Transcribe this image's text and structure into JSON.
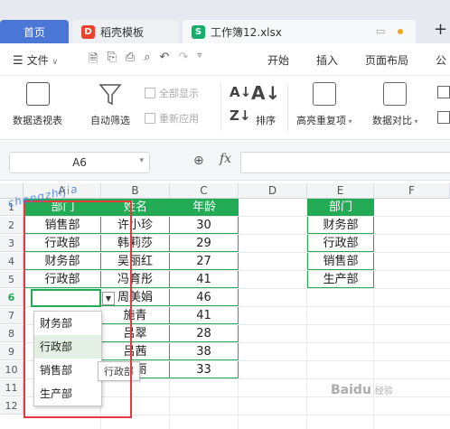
{
  "tabs": {
    "home": "首页",
    "template": "稻壳模板",
    "file": "工作簿12.xlsx",
    "template_badge": "D",
    "file_badge": "S"
  },
  "menu": {
    "file_label": "文件",
    "tabs": [
      "开始",
      "插入",
      "页面布局",
      "公"
    ]
  },
  "ribbon": {
    "pivot": "数据透视表",
    "autofilter": "自动筛选",
    "show_all": "全部显示",
    "reapply": "重新应用",
    "sort": "排序",
    "highlight_dup": "高亮重复项",
    "compare": "数据对比"
  },
  "formula": {
    "name_box": "A6",
    "fx": "fx"
  },
  "grid": {
    "columns": [
      "A",
      "B",
      "C",
      "D",
      "E",
      "F"
    ],
    "rows": [
      "1",
      "2",
      "3",
      "4",
      "5",
      "6",
      "7",
      "8",
      "9",
      "10",
      "11",
      "12"
    ],
    "table": {
      "headers": [
        "部门",
        "姓名",
        "年龄"
      ],
      "rows": [
        [
          "销售部",
          "许小珍",
          "30"
        ],
        [
          "行政部",
          "韩莉莎",
          "29"
        ],
        [
          "财务部",
          "吴丽红",
          "27"
        ],
        [
          "行政部",
          "冯育彤",
          "41"
        ],
        [
          "",
          "周美娟",
          "46"
        ],
        [
          "",
          "施青",
          "41"
        ],
        [
          "",
          "吕翠",
          "28"
        ],
        [
          "",
          "吕茜",
          "38"
        ],
        [
          "",
          "林丽",
          "33"
        ]
      ]
    },
    "dept_list": {
      "header": "部门",
      "items": [
        "财务部",
        "行政部",
        "销售部",
        "生产部"
      ]
    }
  },
  "dropdown": {
    "items": [
      "财务部",
      "行政部",
      "销售部",
      "生产部"
    ],
    "tooltip": "行政部"
  },
  "watermark": "chengzhijia",
  "baidu_mark": "Baidu",
  "baidu_sub": "经验"
}
